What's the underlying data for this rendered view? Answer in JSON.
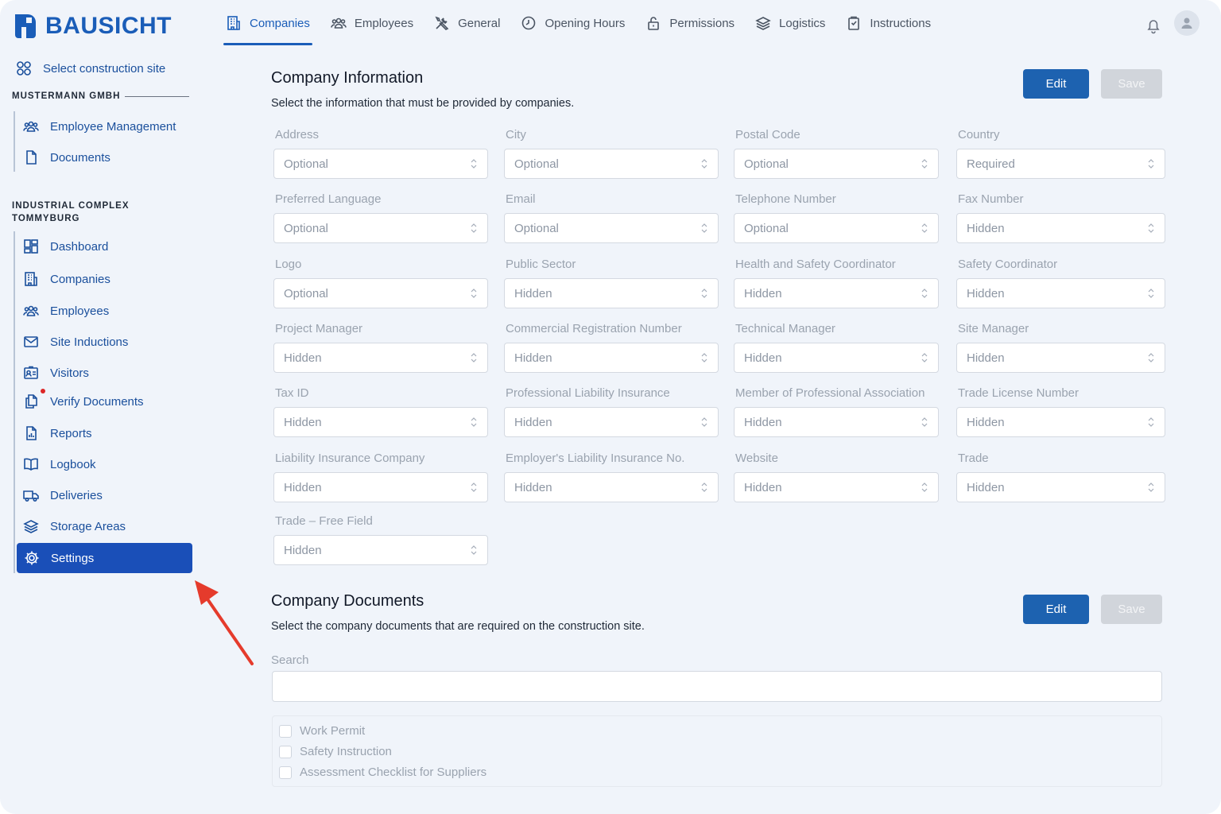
{
  "app": {
    "brand": "BAUSICHT"
  },
  "topnav": {
    "tabs": [
      {
        "label": "Companies",
        "icon": "building-icon",
        "active": true
      },
      {
        "label": "Employees",
        "icon": "users-icon"
      },
      {
        "label": "General",
        "icon": "tools-icon"
      },
      {
        "label": "Opening Hours",
        "icon": "clock-icon"
      },
      {
        "label": "Permissions",
        "icon": "lock-icon"
      },
      {
        "label": "Logistics",
        "icon": "layers-icon"
      },
      {
        "label": "Instructions",
        "icon": "clipboard-icon"
      }
    ]
  },
  "sidebar": {
    "site_select": "Select construction site",
    "group1": {
      "title": "MUSTERMANN GMBH",
      "items": [
        {
          "label": "Employee Management",
          "icon": "users-icon"
        },
        {
          "label": "Documents",
          "icon": "document-icon"
        }
      ]
    },
    "group2": {
      "title_line1": "INDUSTRIAL COMPLEX",
      "title_line2": "TOMMYBURG",
      "items": [
        {
          "label": "Dashboard",
          "icon": "dashboard-icon"
        },
        {
          "label": "Companies",
          "icon": "building-icon"
        },
        {
          "label": "Employees",
          "icon": "users-icon"
        },
        {
          "label": "Site Inductions",
          "icon": "mail-icon"
        },
        {
          "label": "Visitors",
          "icon": "id-card-icon"
        },
        {
          "label": "Verify Documents",
          "icon": "documents-icon",
          "notification_dot": true
        },
        {
          "label": "Reports",
          "icon": "report-icon"
        },
        {
          "label": "Logbook",
          "icon": "book-icon"
        },
        {
          "label": "Deliveries",
          "icon": "truck-icon"
        },
        {
          "label": "Storage Areas",
          "icon": "layers-icon"
        },
        {
          "label": "Settings",
          "icon": "gear-icon",
          "active": true
        }
      ]
    }
  },
  "company_info": {
    "title": "Company Information",
    "description": "Select the information that must be provided by companies.",
    "edit_label": "Edit",
    "save_label": "Save",
    "fields": [
      {
        "label": "Address",
        "value": "Optional"
      },
      {
        "label": "City",
        "value": "Optional"
      },
      {
        "label": "Postal Code",
        "value": "Optional"
      },
      {
        "label": "Country",
        "value": "Required"
      },
      {
        "label": "Preferred Language",
        "value": "Optional"
      },
      {
        "label": "Email",
        "value": "Optional"
      },
      {
        "label": "Telephone Number",
        "value": "Optional"
      },
      {
        "label": "Fax Number",
        "value": "Hidden"
      },
      {
        "label": "Logo",
        "value": "Optional"
      },
      {
        "label": "Public Sector",
        "value": "Hidden"
      },
      {
        "label": "Health and Safety Coordinator",
        "value": "Hidden"
      },
      {
        "label": "Safety Coordinator",
        "value": "Hidden"
      },
      {
        "label": "Project Manager",
        "value": "Hidden"
      },
      {
        "label": "Commercial Registration Number",
        "value": "Hidden"
      },
      {
        "label": "Technical Manager",
        "value": "Hidden"
      },
      {
        "label": "Site Manager",
        "value": "Hidden"
      },
      {
        "label": "Tax ID",
        "value": "Hidden"
      },
      {
        "label": "Professional Liability Insurance",
        "value": "Hidden"
      },
      {
        "label": "Member of Professional Association",
        "value": "Hidden"
      },
      {
        "label": "Trade License Number",
        "value": "Hidden"
      },
      {
        "label": "Liability Insurance Company",
        "value": "Hidden"
      },
      {
        "label": "Employer's Liability Insurance No.",
        "value": "Hidden"
      },
      {
        "label": "Website",
        "value": "Hidden"
      },
      {
        "label": "Trade",
        "value": "Hidden"
      },
      {
        "label": "Trade – Free Field",
        "value": "Hidden"
      }
    ]
  },
  "company_docs": {
    "title": "Company Documents",
    "description": "Select the company documents that are required on the construction site.",
    "edit_label": "Edit",
    "save_label": "Save",
    "search_label": "Search",
    "search_value": "",
    "items": [
      {
        "label": "Work Permit",
        "checked": false
      },
      {
        "label": "Safety Instruction",
        "checked": false
      },
      {
        "label": "Assessment Checklist for Suppliers",
        "checked": false
      }
    ]
  },
  "colors": {
    "accent": "#1a5db8",
    "active_nav": "#1a4fb8",
    "annotation_arrow": "#e53b2c",
    "notification": "#dc2626"
  }
}
